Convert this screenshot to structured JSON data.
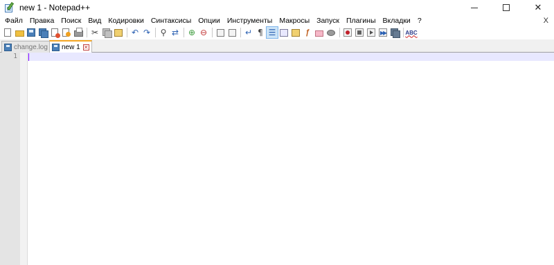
{
  "window": {
    "title": "new 1 - Notepad++",
    "minimize_glyph": "minimize-icon",
    "maximize_glyph": "maximize-icon",
    "close_label": "✕"
  },
  "menu": {
    "items": [
      "Файл",
      "Правка",
      "Поиск",
      "Вид",
      "Кодировки",
      "Синтаксисы",
      "Опции",
      "Инструменты",
      "Макросы",
      "Запуск",
      "Плагины",
      "Вкладки",
      "?"
    ],
    "close_doc_label": "X"
  },
  "toolbar": {
    "spell_check_label": "ABC",
    "icons": [
      "new-file-icon",
      "open-file-icon",
      "save-icon",
      "save-all-icon",
      "close-icon",
      "close-all-icon",
      "print-icon",
      "cut-icon",
      "copy-icon",
      "paste-icon",
      "undo-icon",
      "redo-icon",
      "find-icon",
      "replace-icon",
      "zoom-in-icon",
      "zoom-out-icon",
      "sync-vertical-icon",
      "sync-horizontal-icon",
      "word-wrap-icon",
      "show-all-chars-icon",
      "indent-guide-icon",
      "doc-map-icon",
      "function-list-icon",
      "folder-as-workspace-icon",
      "monitoring-icon",
      "record-macro-icon",
      "stop-macro-icon",
      "play-macro-icon",
      "run-macro-multiple-icon",
      "save-macro-icon",
      "spell-check-icon"
    ]
  },
  "tabs": [
    {
      "label": "change.log",
      "close": "✕",
      "active": false
    },
    {
      "label": "new 1",
      "close": "✕",
      "active": true
    }
  ],
  "editor": {
    "line_numbers": [
      "1"
    ],
    "content": ""
  }
}
